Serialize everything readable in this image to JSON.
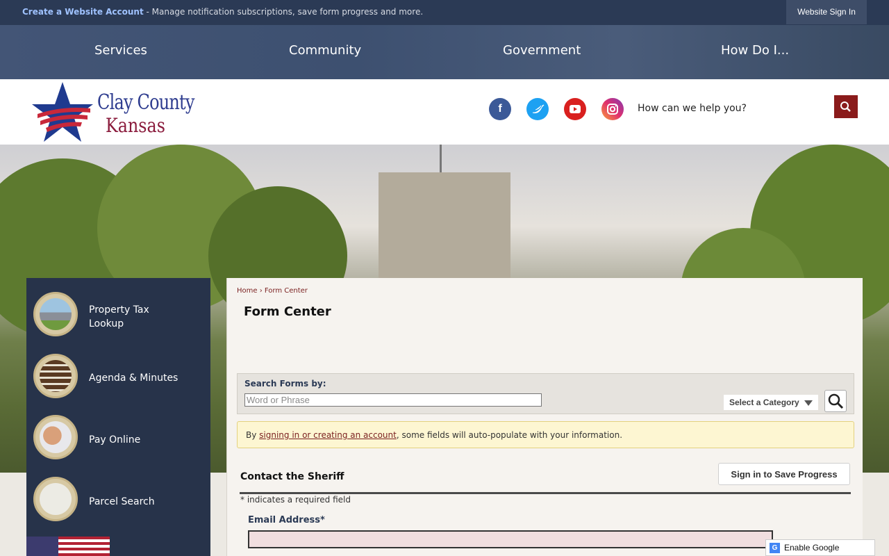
{
  "topbar": {
    "create_link": "Create a Website Account",
    "create_desc": " - Manage notification subscriptions, save form progress and more.",
    "signin": "Website Sign In"
  },
  "nav": {
    "items": [
      "Services",
      "Community",
      "Government",
      "How Do I..."
    ]
  },
  "header": {
    "logo_line1": "Clay County",
    "logo_line2": "Kansas",
    "search_placeholder": "How can we help you?",
    "social": [
      "facebook-icon",
      "twitter-icon",
      "youtube-icon",
      "instagram-icon"
    ]
  },
  "sidebar": {
    "items": [
      {
        "label": "Property Tax Lookup",
        "icon": "house-icon"
      },
      {
        "label": "Agenda & Minutes",
        "icon": "books-icon"
      },
      {
        "label": "Pay Online",
        "icon": "payment-hand-icon"
      },
      {
        "label": "Parcel Search",
        "icon": "map-icon"
      }
    ]
  },
  "main": {
    "breadcrumb_home": "Home",
    "breadcrumb_sep": " › ",
    "breadcrumb_current": "Form Center",
    "title": "Form Center",
    "search_label": "Search Forms by:",
    "search_placeholder": "Word or Phrase",
    "category": "Select a Category",
    "notice_pre": "By ",
    "notice_link": "signing in or creating an account",
    "notice_post": ", some fields will auto-populate with your information.",
    "form_title": "Contact the Sheriff",
    "save_button": "Sign in to Save Progress",
    "required_note": "* indicates a required field",
    "email_label": "Email Address*"
  },
  "translate": {
    "label": "Enable Google Translate"
  },
  "colors": {
    "navy": "#27334a",
    "accent": "#8a1b1b",
    "link": "#7a1f1f"
  }
}
